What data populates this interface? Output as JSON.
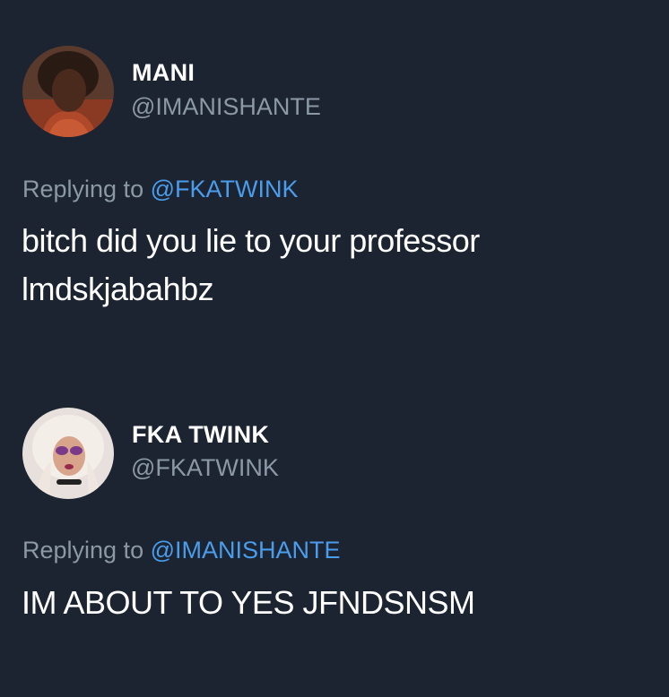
{
  "colors": {
    "background": "#1c2431",
    "name_text": "#ffffff",
    "secondary_text": "#8b98a6",
    "link": "#4a9cec"
  },
  "tweets": [
    {
      "display_name": "MANI",
      "handle": "@IMANISHANTE",
      "avatar_icon": "user-avatar-photo",
      "reply_prefix": "Replying to",
      "reply_to": "@FKATWINK",
      "body_lines": [
        "bitch did you lie to your professor",
        "lmdskjabahbz"
      ]
    },
    {
      "display_name": "FKA TWINK",
      "handle": "@FKATWINK",
      "avatar_icon": "user-avatar-photo",
      "reply_prefix": "Replying to",
      "reply_to": "@IMANISHANTE",
      "body_lines": [
        "IM ABOUT TO YES JFNDSNSM"
      ]
    }
  ]
}
